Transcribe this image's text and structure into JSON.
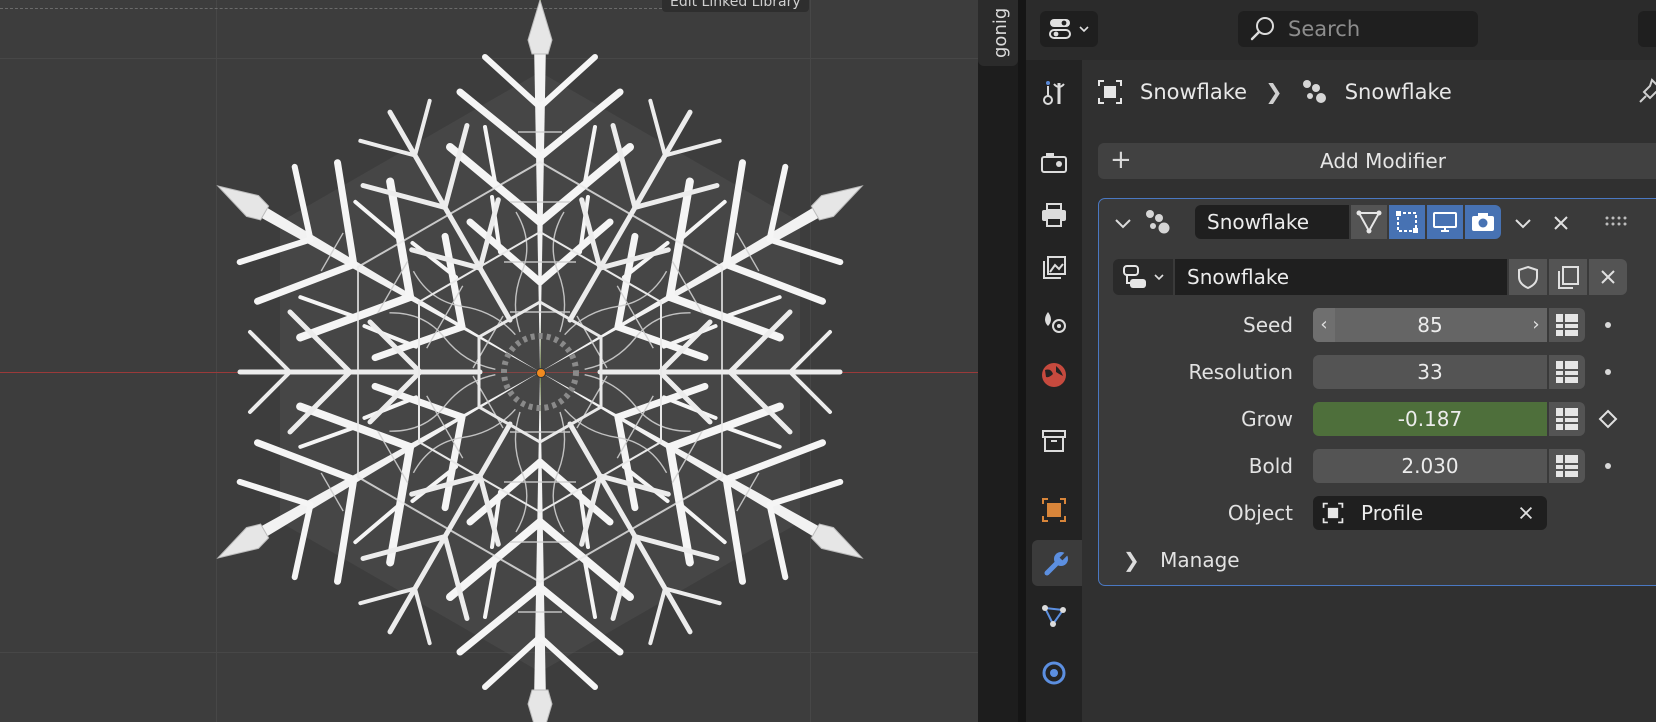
{
  "viewport": {
    "header_hint": "Edit Linked Library"
  },
  "side_tab": {
    "label": "gonig"
  },
  "properties": {
    "search": {
      "placeholder": "Search",
      "value": ""
    },
    "breadcrumb": {
      "object": "Snowflake",
      "modifier": "Snowflake"
    },
    "add_modifier_label": "Add Modifier",
    "tabs": [
      {
        "name": "tool"
      },
      {
        "name": "render"
      },
      {
        "name": "output"
      },
      {
        "name": "view-layer"
      },
      {
        "name": "scene"
      },
      {
        "name": "world"
      },
      {
        "name": "collection"
      },
      {
        "name": "object"
      },
      {
        "name": "modifiers",
        "active": true
      },
      {
        "name": "particles"
      },
      {
        "name": "physics"
      }
    ],
    "modifier": {
      "name": "Snowflake",
      "node_group": "Snowflake",
      "fields": {
        "seed": {
          "label": "Seed",
          "value": "85"
        },
        "resolution": {
          "label": "Resolution",
          "value": "33"
        },
        "grow": {
          "label": "Grow",
          "value": "-0.187"
        },
        "bold": {
          "label": "Bold",
          "value": "2.030"
        },
        "object": {
          "label": "Object",
          "value": "Profile"
        }
      },
      "manage_label": "Manage"
    }
  },
  "colors": {
    "accent_blue": "#4772b3",
    "keyed_green": "#4e6f3b",
    "panel_outline": "#4a78c2"
  }
}
